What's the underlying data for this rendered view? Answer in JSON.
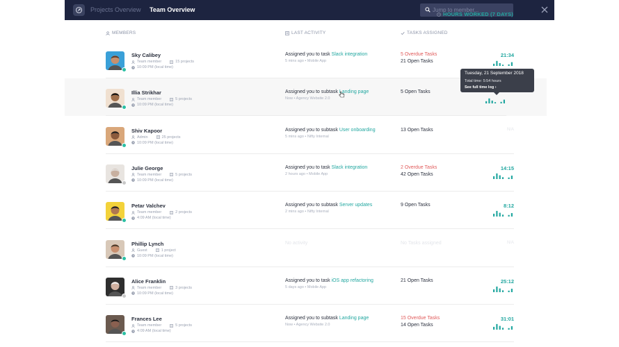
{
  "header": {
    "tab_projects": "Projects Overview",
    "tab_team": "Team Overview",
    "search_placeholder": "Jump to member..."
  },
  "columns": {
    "members": "MEMBERS",
    "last_activity": "LAST ACTIVITY",
    "tasks_assigned": "TASKS ASSIGNED",
    "hours_worked": "HOURS WORKED (7 DAYS)"
  },
  "members": [
    {
      "name": "Sky Calibey",
      "role": "Team member",
      "projects": "15 projects",
      "time": "10:09 PM (local time)",
      "activity_prefix": "Assigned you to task ",
      "activity_link": "Slack integration",
      "activity_sub": "5 mins ago • Mobile App",
      "task_overdue": "5 Overdue Tasks",
      "task_open": "21 Open Tasks",
      "hours": "21:34",
      "online": true,
      "bars": [
        0.35,
        0.8,
        0.45,
        0.2,
        0.0,
        0.25,
        0.6
      ]
    },
    {
      "name": "Illia Strikhar",
      "role": "Team member",
      "projects": "5 projects",
      "time": "10:09 PM (local time)",
      "activity_prefix": "Assigned you to subtask ",
      "activity_link": "Landing page",
      "activity_sub": "Now • Agency Website 2.0",
      "task_overdue": "",
      "task_open": "5 Open Tasks",
      "hours": "",
      "online": true,
      "bars": [
        0.35,
        0.8,
        0.45,
        0.2,
        0.0,
        0.25,
        0.6
      ]
    },
    {
      "name": "Shiv Kapoor",
      "role": "Admin",
      "projects": "25 projects",
      "time": "10:09 PM (local time)",
      "activity_prefix": "Assigned you to subtask ",
      "activity_link": "User onboarding",
      "activity_sub": "5 mins ago • Nifty Internal",
      "task_overdue": "",
      "task_open": "13 Open Tasks",
      "hours": "N/A",
      "online": true,
      "bars": []
    },
    {
      "name": "Julie George",
      "role": "Team member",
      "projects": "5 projects",
      "time": "10:09 PM (local time)",
      "activity_prefix": "Assigned you to task ",
      "activity_link": "Slack integration",
      "activity_sub": "2 hours ago • Mobile App",
      "task_overdue": "2 Overdue Tasks",
      "task_open": "42 Open Tasks",
      "hours": "14:15",
      "online": false,
      "bars": [
        0.45,
        0.9,
        0.6,
        0.3,
        0.0,
        0.25,
        0.55
      ]
    },
    {
      "name": "Petar Valchev",
      "role": "Team member",
      "projects": "2 projects",
      "time": "4:09 AM (local time)",
      "activity_prefix": "Assigned you to subtask ",
      "activity_link": "Server updates",
      "activity_sub": "2 mins ago • Nifty Internal",
      "task_overdue": "",
      "task_open": "9 Open Tasks",
      "hours": "8:12",
      "online": true,
      "bars": [
        0.45,
        0.9,
        0.6,
        0.3,
        0.0,
        0.25,
        0.55
      ]
    },
    {
      "name": "Phillip Lynch",
      "role": "Guest",
      "projects": "1 project",
      "time": "10:09 PM (local time)",
      "activity_prefix": "No activity",
      "activity_link": "",
      "activity_sub": "",
      "task_overdue": "",
      "task_open": "No Tasks assigned",
      "hours": "N/A",
      "online": true,
      "bars": []
    },
    {
      "name": "Alice Franklin",
      "role": "Team member",
      "projects": "3 projects",
      "time": "10:09 PM (local time)",
      "activity_prefix": "Assigned you to task ",
      "activity_link": "iOS app refactoring",
      "activity_sub": "5 days ago • Mobile App",
      "task_overdue": "",
      "task_open": "21 Open Tasks",
      "hours": "25:12",
      "online": false,
      "bars": [
        0.45,
        0.9,
        0.6,
        0.3,
        0.0,
        0.25,
        0.55
      ]
    },
    {
      "name": "Frances Lee",
      "role": "Team member",
      "projects": "5 projects",
      "time": "4:09 AM (local time)",
      "activity_prefix": "Assigned you to subtask ",
      "activity_link": "Landing page",
      "activity_sub": "Now • Agency Website 2.0",
      "task_overdue": "15 Overdue Tasks",
      "task_open": "14 Open Tasks",
      "hours": "31:01",
      "online": true,
      "bars": [
        0.45,
        0.9,
        0.6,
        0.3,
        0.0,
        0.25,
        0.55
      ]
    }
  ],
  "tooltip": {
    "date": "Tuesday, 21 September 2018",
    "total": "Total time: 5:54 hours",
    "link": "See full time log ›"
  },
  "colors": {
    "accent": "#22a7a0",
    "overdue": "#e05a5a",
    "topbar": "#1d2440"
  }
}
